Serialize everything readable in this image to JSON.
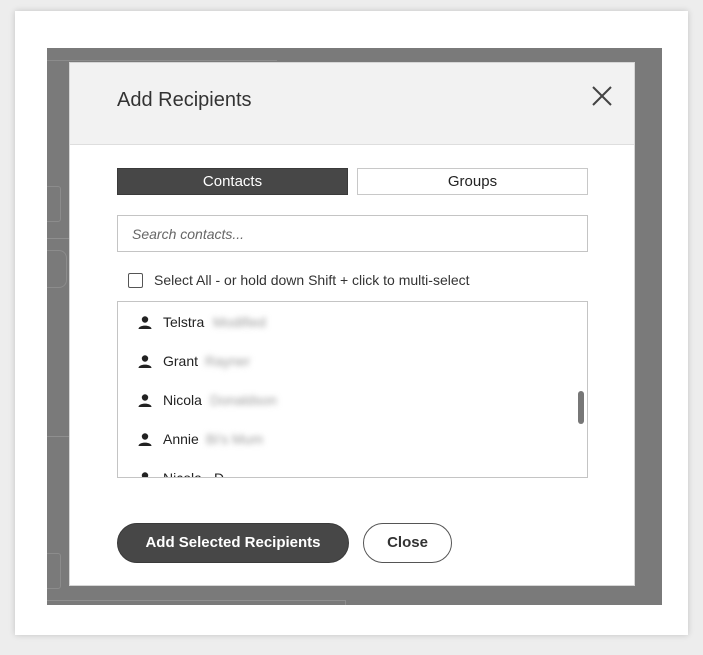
{
  "dialog": {
    "title": "Add Recipients",
    "close_icon": "close-icon"
  },
  "tabs": {
    "contacts": "Contacts",
    "groups": "Groups",
    "active": "Contacts"
  },
  "search": {
    "placeholder": "Search contacts..."
  },
  "select_all": {
    "label": "Select All - or hold down Shift + click to multi-select",
    "checked": false
  },
  "contacts": [
    {
      "first": "Telstra",
      "last": "Modified"
    },
    {
      "first": "Grant",
      "last": "Rayner"
    },
    {
      "first": "Nicola",
      "last": "Donaldson"
    },
    {
      "first": "Annie",
      "last": "Bi's Mum"
    },
    {
      "first": "Nicola",
      "last": "D"
    }
  ],
  "buttons": {
    "add_selected": "Add Selected Recipients",
    "close": "Close"
  },
  "colors": {
    "primary": "#474747",
    "overlay": "#7a7a7a",
    "header_bg": "#f2f2f2"
  }
}
